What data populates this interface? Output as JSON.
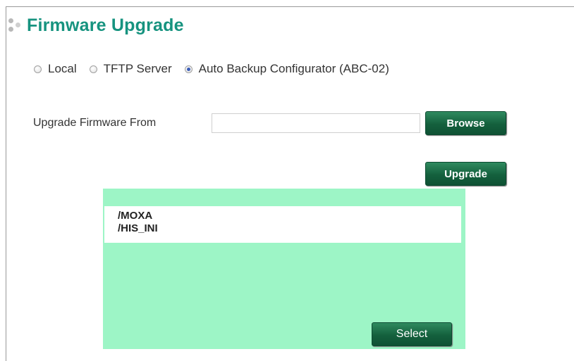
{
  "header": {
    "title": "Firmware Upgrade",
    "icon": "dots-icon"
  },
  "source_options": [
    {
      "label": "Local",
      "checked": false
    },
    {
      "label": "TFTP Server",
      "checked": false
    },
    {
      "label": "Auto Backup Configurator (ABC-02)",
      "checked": true
    }
  ],
  "upgrade_from": {
    "label": "Upgrade Firmware From",
    "value": "",
    "browse_label": "Browse"
  },
  "upgrade_button": "Upgrade",
  "abc_panel": {
    "directories": [
      "/MOXA",
      "/HIS_INI"
    ],
    "select_label": "Select",
    "background": "#9df5c6"
  },
  "colors": {
    "title": "#16937f",
    "button": "#14603d"
  }
}
